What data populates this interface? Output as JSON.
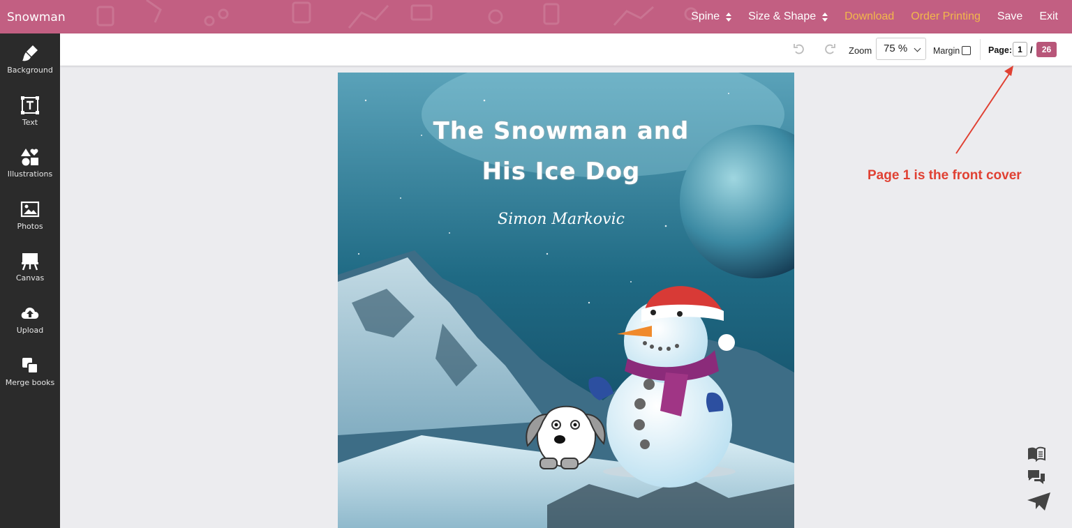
{
  "app": {
    "title": "Snowman"
  },
  "topnav": {
    "spine": "Spine",
    "size_shape": "Size & Shape",
    "download": "Download",
    "order_printing": "Order Printing",
    "save": "Save",
    "exit": "Exit"
  },
  "sidebar": {
    "items": [
      {
        "label": "Background",
        "icon": "brush-icon"
      },
      {
        "label": "Text",
        "icon": "text-icon"
      },
      {
        "label": "Illustrations",
        "icon": "shapes-icon"
      },
      {
        "label": "Photos",
        "icon": "image-icon"
      },
      {
        "label": "Canvas",
        "icon": "easel-icon"
      },
      {
        "label": "Upload",
        "icon": "cloud-upload-icon"
      },
      {
        "label": "Merge books",
        "icon": "merge-icon"
      }
    ]
  },
  "toolbar": {
    "zoom_label": "Zoom",
    "zoom_value": "75 %",
    "margin_label": "Margin",
    "page_label": "Page:",
    "page_current": "1",
    "page_separator": "/",
    "page_total": "26"
  },
  "cover": {
    "title_line1": "The Snowman and",
    "title_line2": "His Ice Dog",
    "author": "Simon Markovic"
  },
  "annotation": {
    "text": "Page 1 is the front cover"
  },
  "colors": {
    "topbar": "#c25f82",
    "accent": "#f2b84b",
    "sidebar": "#2b2b2b",
    "page_badge": "#b85679",
    "annotation": "#e04133"
  }
}
